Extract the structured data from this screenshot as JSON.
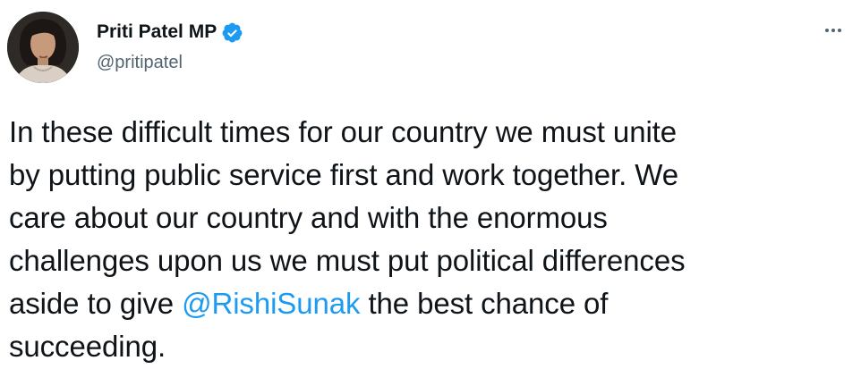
{
  "author": {
    "display_name": "Priti Patel MP",
    "handle": "@pritipatel",
    "verified": true
  },
  "menu": {
    "icon": "more-icon"
  },
  "tweet": {
    "line1": "In these difficult times for our country we must unite",
    "line2": "by putting public service first and work together. We",
    "line3": "care about our country and with the enormous",
    "line4": "challenges upon us we must put political differences",
    "line5_before": "aside to give ",
    "mention": "@RishiSunak",
    "line5_after": " the best chance of",
    "line6": "succeeding."
  },
  "colors": {
    "text": "#0f1419",
    "secondary": "#536471",
    "link": "#1d9bf0",
    "verified_badge": "#1d9bf0"
  }
}
